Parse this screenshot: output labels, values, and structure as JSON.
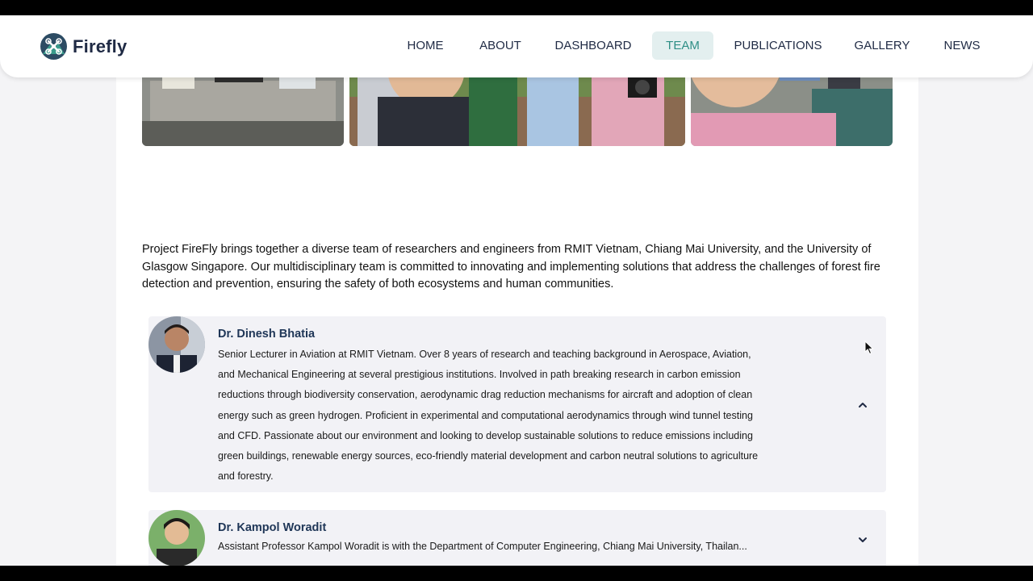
{
  "app": {
    "brand": "Firefly"
  },
  "nav": {
    "items": [
      {
        "label": "HOME",
        "active": false
      },
      {
        "label": "ABOUT",
        "active": false
      },
      {
        "label": "DASHBOARD",
        "active": false
      },
      {
        "label": "TEAM",
        "active": true
      },
      {
        "label": "PUBLICATIONS",
        "active": false
      },
      {
        "label": "GALLERY",
        "active": false
      },
      {
        "label": "NEWS",
        "active": false
      }
    ]
  },
  "intro": {
    "text": "Project FireFly brings together a diverse team of researchers and engineers from RMIT Vietnam, Chiang Mai University, and the University of Glasgow Singapore. Our multidisciplinary team is committed to innovating and implementing solutions that address the challenges of forest fire detection and prevention, ensuring the safety of both ecosystems and human communities."
  },
  "team": [
    {
      "name": "Dr. Dinesh Bhatia",
      "bio": "Senior Lecturer in Aviation at RMIT Vietnam. Over 8 years of research and teaching background in Aerospace, Aviation, and Mechanical Engineering at several prestigious institutions. Involved in path breaking research in carbon emission reductions through biodiversity conservation, aerodynamic drag reduction mechanisms for aircraft and adoption of clean energy such as green hydrogen. Proficient in experimental and computational aerodynamics through wind tunnel testing and CFD. Passionate about our environment and looking to develop sustainable solutions to reduce emissions including green buildings, renewable energy sources, eco-friendly material development and carbon neutral solutions to agriculture and forestry.",
      "expanded": true,
      "toggle_icon": "chevron-up-icon"
    },
    {
      "name": "Dr. Kampol Woradit",
      "bio": "Assistant Professor Kampol Woradit is with the Department of Computer Engineering, Chiang Mai University, Thailan...",
      "expanded": false,
      "toggle_icon": "chevron-down-icon"
    }
  ],
  "colors": {
    "accent": "#2f8f86",
    "active_bg": "#e3efef",
    "heading": "#1f3657",
    "card_bg": "#f2f2f6"
  }
}
